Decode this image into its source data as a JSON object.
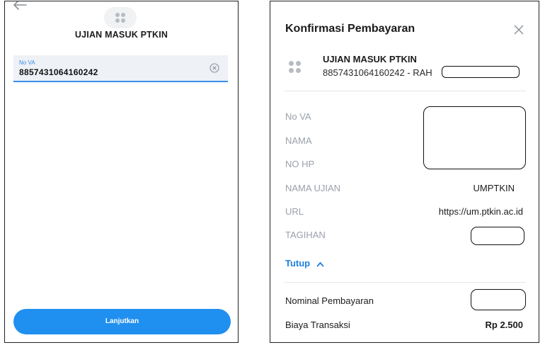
{
  "left_screen": {
    "title": "UJIAN MASUK PTKIN",
    "va_field": {
      "label": "No VA",
      "value": "8857431064160242"
    },
    "continue_label": "Lanjutkan",
    "icons": {
      "back": "arrow-left-icon",
      "service": "grid-dots-icon",
      "clear": "clear-circle-icon"
    }
  },
  "right_screen": {
    "title": "Konfirmasi Pembayaran",
    "service": {
      "name": "UJIAN MASUK PTKIN",
      "subtitle": "8857431064160242 - RAH"
    },
    "details": [
      {
        "label": "No VA",
        "value": ""
      },
      {
        "label": "NAMA",
        "value": ""
      },
      {
        "label": "NO HP",
        "value": ""
      },
      {
        "label": "NAMA UJIAN",
        "value": "UMPTKIN"
      },
      {
        "label": "URL",
        "value": "https://um.ptkin.ac.id"
      },
      {
        "label": "TAGIHAN",
        "value": ""
      }
    ],
    "toggle_label": "Tutup",
    "summary": [
      {
        "label": "Nominal Pembayaran",
        "value": ""
      },
      {
        "label": "Biaya Transaksi",
        "value": "Rp 2.500"
      }
    ],
    "icons": {
      "close": "close-icon",
      "toggle": "chevron-up-icon"
    }
  },
  "colors": {
    "accent": "#1f8ff0",
    "link": "#1f7fe0",
    "field_bg": "#eef1f6",
    "muted_text": "#9aa1aa"
  }
}
